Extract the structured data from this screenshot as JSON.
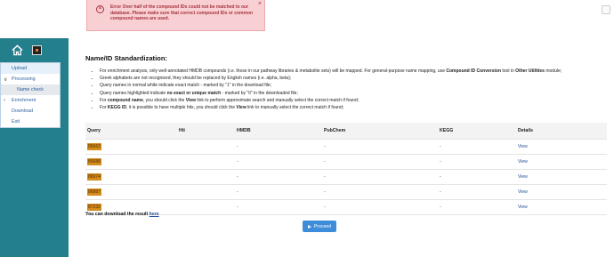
{
  "error": {
    "label": "Error",
    "message": "Over half of the compound IDs could not be matched to our database. Please make sure that correct compound IDs or common compound names are used.",
    "close": "×"
  },
  "sidebar": {
    "items": [
      {
        "label": "Upload"
      },
      {
        "label": "Processing"
      },
      {
        "label": "Name check"
      },
      {
        "label": "Enrichment"
      },
      {
        "label": "Download"
      },
      {
        "label": "Exit"
      }
    ]
  },
  "page": {
    "title": "Name/ID Standardization:",
    "bullets": [
      {
        "pre": "For enrichment analysis, only well-annotated HMDB compounds (i.e. those in our pathway libraries & metabolite sets) will be mapped. For general-purpose name mapping, use ",
        "b1": "Compound ID Conversion",
        "mid": " tool in ",
        "b2": "Other Utilities",
        "post": " module;"
      },
      {
        "pre": "Greek alphabets are not recognized, they should be replaced by English names (i.e. alpha, beta);",
        "b1": "",
        "mid": "",
        "b2": "",
        "post": ""
      },
      {
        "pre": "Query names in normal white indicate exact match - marked by \"1\" in the download file;",
        "b1": "",
        "mid": "",
        "b2": "",
        "post": ""
      },
      {
        "pre": "Query names highlighted indicate ",
        "b1": "no exact or unique match",
        "mid": " - marked by \"0\" in the downloaded file;",
        "b2": "",
        "post": ""
      },
      {
        "pre": "For ",
        "b1": "compound name",
        "mid": ", you should click the ",
        "b2": "View",
        "post": " link to perform approximate search and manually select the correct match if found;"
      },
      {
        "pre": "For ",
        "b1": "KEGG ID",
        "mid": ", it is possible to have multiple hits, you should click the ",
        "b2": "View",
        "post": " link to manually select the correct match if found;"
      }
    ]
  },
  "table": {
    "headers": [
      "Query",
      "Hit",
      "HMDB",
      "PubChem",
      "KEGG",
      "Details"
    ],
    "rows": [
      {
        "query": "85663",
        "hit": "",
        "hmdb": "-",
        "pubchem": "-",
        "kegg": "-",
        "details": "View"
      },
      {
        "query": "85688",
        "hit": "",
        "hmdb": "-",
        "pubchem": "-",
        "kegg": "-",
        "details": "View"
      },
      {
        "query": "86974",
        "hit": "",
        "hmdb": "-",
        "pubchem": "-",
        "kegg": "-",
        "details": "View"
      },
      {
        "query": "86887",
        "hit": "",
        "hmdb": "-",
        "pubchem": "-",
        "kegg": "-",
        "details": "View"
      },
      {
        "query": "87232",
        "hit": "",
        "hmdb": "-",
        "pubchem": "-",
        "kegg": "-",
        "details": "View"
      }
    ]
  },
  "download": {
    "text": "You can download the result ",
    "link": "here"
  },
  "proceed": {
    "label": "Proceed"
  }
}
